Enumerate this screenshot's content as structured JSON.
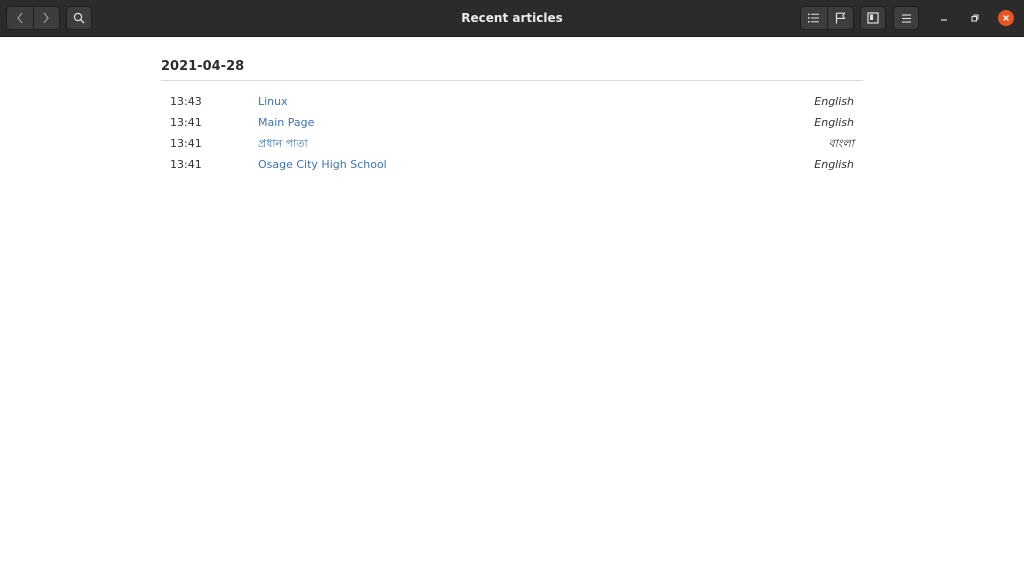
{
  "window": {
    "title": "Recent articles"
  },
  "header": {
    "back_icon": "chevron-left-icon",
    "forward_icon": "chevron-right-icon",
    "search_icon": "search-icon",
    "toc_icon": "list-icon",
    "bookmark_icon": "flag-icon",
    "reader_icon": "book-icon",
    "menu_icon": "hamburger-icon",
    "accent": "#e95420"
  },
  "recent": {
    "date": "2021-04-28",
    "entries": [
      {
        "time": "13:43",
        "title": "Linux",
        "language": "English"
      },
      {
        "time": "13:41",
        "title": "Main Page",
        "language": "English"
      },
      {
        "time": "13:41",
        "title": "প্রধান পাতা",
        "language": "বাংলা"
      },
      {
        "time": "13:41",
        "title": "Osage City High School",
        "language": "English"
      }
    ]
  }
}
